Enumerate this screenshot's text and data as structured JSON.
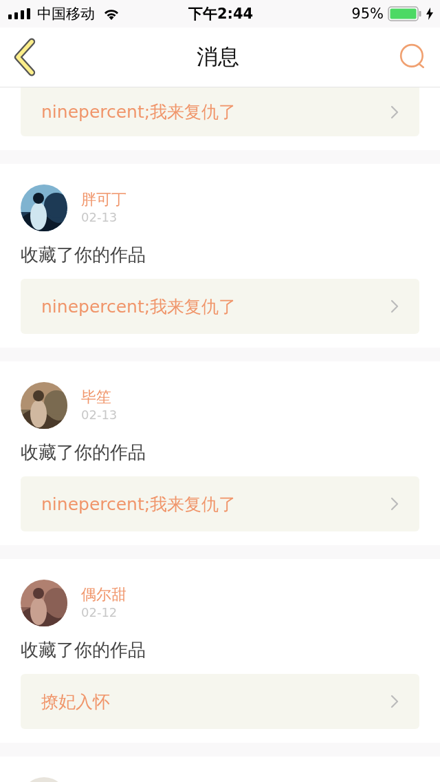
{
  "status_bar": {
    "carrier": "中国移动",
    "time": "下午2:44",
    "battery": "95%"
  },
  "nav": {
    "title": "消息"
  },
  "messages": [
    {
      "work": "ninepercent;我来复仇了"
    },
    {
      "avatar": {
        "kind": "picture"
      },
      "name": "胖可丁",
      "date": "02-13",
      "action": "收藏了你的作品",
      "work": "ninepercent;我来复仇了"
    },
    {
      "avatar": {
        "kind": "picture"
      },
      "name": "毕笙",
      "date": "02-13",
      "action": "收藏了你的作品",
      "work": "ninepercent;我来复仇了"
    },
    {
      "avatar": {
        "kind": "picture"
      },
      "name": "偶尔甜",
      "date": "02-12",
      "action": "收藏了你的作品",
      "work": "撩妃入怀"
    },
    {
      "avatar": {
        "kind": "picture"
      }
    }
  ]
}
